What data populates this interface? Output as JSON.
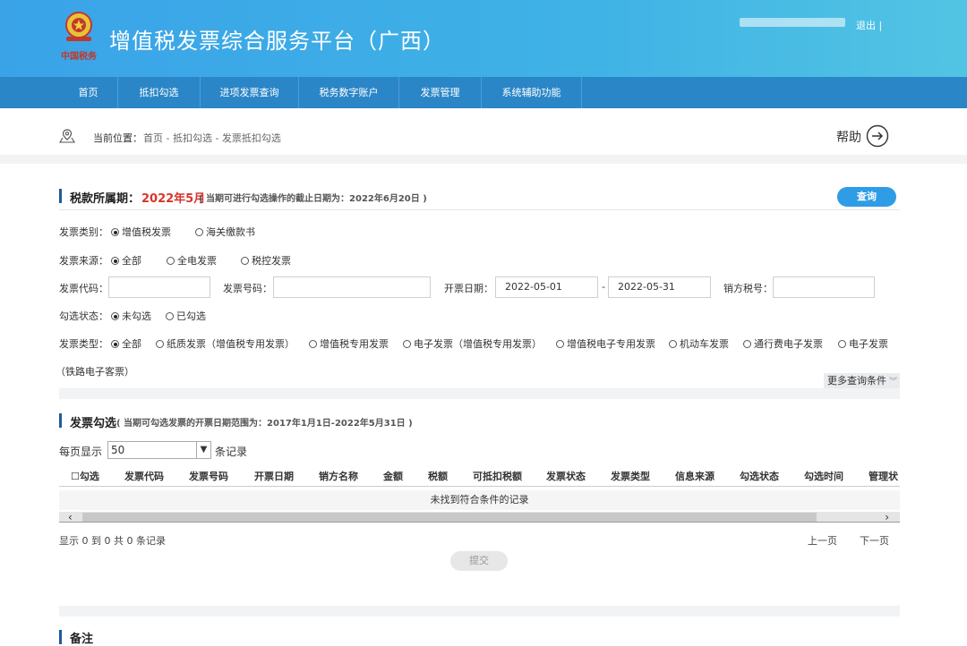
{
  "header": {
    "title": "增值税发票综合服务平台（广西）",
    "emblem_text": "中国税务",
    "logout": "退出 |"
  },
  "nav": {
    "items": [
      "首页",
      "抵扣勾选",
      "进项发票查询",
      "税务数字账户",
      "发票管理",
      "系统辅助功能"
    ]
  },
  "breadcrumb": {
    "label": "当前位置：",
    "path": "首页 - 抵扣勾选 - 发票抵扣勾选",
    "help": "帮助"
  },
  "query": {
    "period_label": "税款所属期：",
    "period_value": "2022年5月",
    "period_note": "( 当期可进行勾选操作的截止日期为：2022年6月20日 )",
    "button": "查询",
    "invoice_category": {
      "label": "发票类别：",
      "options": [
        {
          "text": "增值税发票",
          "selected": true
        },
        {
          "text": "海关缴款书",
          "selected": false
        }
      ]
    },
    "invoice_source": {
      "label": "发票来源：",
      "options": [
        {
          "text": "全部",
          "selected": true
        },
        {
          "text": "全电发票",
          "selected": false
        },
        {
          "text": "税控发票",
          "selected": false
        }
      ]
    },
    "code_label": "发票代码：",
    "number_label": "发票号码：",
    "date_label": "开票日期：",
    "date_from": "2022-05-01",
    "date_sep": "-",
    "date_to": "2022-05-31",
    "seller_tax_label": "销方税号：",
    "check_status": {
      "label": "勾选状态：",
      "options": [
        {
          "text": "未勾选",
          "selected": true
        },
        {
          "text": "已勾选",
          "selected": false
        }
      ]
    },
    "invoice_type": {
      "label": "发票类型：",
      "options": [
        {
          "text": "全部",
          "selected": true
        },
        {
          "text": "纸质发票（增值税专用发票）",
          "selected": false
        },
        {
          "text": "增值税专用发票",
          "selected": false
        },
        {
          "text": "电子发票（增值税专用发票）",
          "selected": false
        },
        {
          "text": "增值税电子专用发票",
          "selected": false
        },
        {
          "text": "机动车发票",
          "selected": false
        },
        {
          "text": "通行费电子发票",
          "selected": false
        },
        {
          "text": "电子发票",
          "selected": false
        }
      ],
      "wrap_text": "（铁路电子客票）"
    },
    "more": "更多查询条件"
  },
  "selection": {
    "title": "发票勾选",
    "note": "( 当期可勾选发票的开票日期范围为：2017年1月1日-2022年5月31日 )",
    "per_page_label": "每页显示",
    "per_page_value": "50",
    "per_page_suffix": "条记录",
    "columns": [
      "☐勾选",
      "发票代码",
      "发票号码",
      "开票日期",
      "销方名称",
      "金额",
      "税额",
      "可抵扣税额",
      "发票状态",
      "发票类型",
      "信息来源",
      "勾选状态",
      "勾选时间",
      "管理状"
    ],
    "empty_text": "未找到符合条件的记录",
    "summary": "显示 0 到 0 共 0 条记录",
    "prev": "上一页",
    "next": "下一页",
    "submit": "提交"
  },
  "remarks": {
    "title": "备注"
  }
}
